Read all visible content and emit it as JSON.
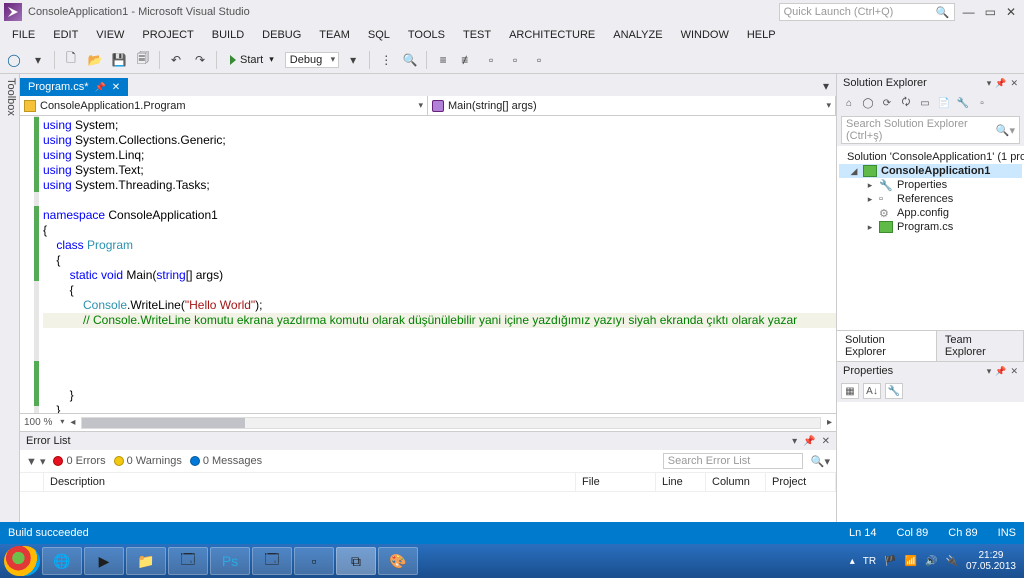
{
  "title": "ConsoleApplication1 - Microsoft Visual Studio",
  "quick_launch_placeholder": "Quick Launch (Ctrl+Q)",
  "menu": [
    "FILE",
    "EDIT",
    "VIEW",
    "PROJECT",
    "BUILD",
    "DEBUG",
    "TEAM",
    "SQL",
    "TOOLS",
    "TEST",
    "ARCHITECTURE",
    "ANALYZE",
    "WINDOW",
    "HELP"
  ],
  "toolbar": {
    "start": "Start",
    "config": "Debug"
  },
  "left_tool": "Toolbox",
  "tab": {
    "name": "Program.cs*",
    "pinned": false
  },
  "nav": {
    "scope": "ConsoleApplication1.Program",
    "member": "Main(string[] args)"
  },
  "code": {
    "lines": [
      {
        "t": "using ",
        "k": true,
        "r": "System;"
      },
      {
        "t": "using ",
        "k": true,
        "r": "System.Collections.Generic;"
      },
      {
        "t": "using ",
        "k": true,
        "r": "System.Linq;"
      },
      {
        "t": "using ",
        "k": true,
        "r": "System.Text;"
      },
      {
        "t": "using ",
        "k": true,
        "r": "System.Threading.Tasks;"
      }
    ],
    "ns": "namespace",
    "ns_name": " ConsoleApplication1",
    "class_kw": "class",
    "class_name": " Program",
    "static_kw": "static",
    "void_kw": " void",
    "main": " Main(",
    "string_kw": "string",
    "main_rest": "[] args)",
    "console": "Console",
    "write": ".WriteLine(",
    "hello": "\"Hello World\"",
    "close": ");",
    "comment": "// Console.WriteLine komutu ekrana yazdırma komutu olarak düşünülebilir yani içine yazdığımız yazıyı siyah ekranda çıktı olarak yazar"
  },
  "zoom": "100 %",
  "error_panel": {
    "title": "Error List",
    "filters": {
      "errors": "0 Errors",
      "warnings": "0 Warnings",
      "messages": "0 Messages"
    },
    "search_placeholder": "Search Error List",
    "cols": [
      "",
      "Description",
      "File",
      "Line",
      "Column",
      "Project"
    ]
  },
  "status": {
    "build": "Build succeeded",
    "ln": "Ln 14",
    "col": "Col 89",
    "ch": "Ch 89",
    "ins": "INS"
  },
  "solution_explorer": {
    "title": "Solution Explorer",
    "search_placeholder": "Search Solution Explorer (Ctrl+ş)",
    "solution": "Solution 'ConsoleApplication1' (1 pro",
    "project": "ConsoleApplication1",
    "nodes": [
      "Properties",
      "References",
      "App.config",
      "Program.cs"
    ],
    "tabs": [
      "Solution Explorer",
      "Team Explorer"
    ]
  },
  "properties": {
    "title": "Properties"
  },
  "tray": {
    "lang": "TR",
    "time": "21:29",
    "date": "07.05.2013"
  }
}
